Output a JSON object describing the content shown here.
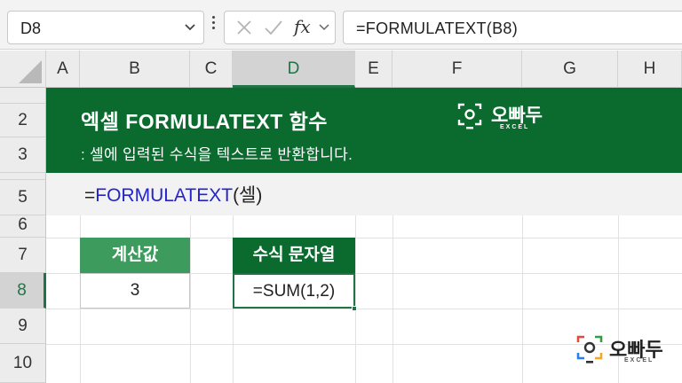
{
  "formula_bar": {
    "name_box": "D8",
    "fx_label": "fx",
    "formula": "=FORMULATEXT(B8)"
  },
  "columns": [
    "A",
    "B",
    "C",
    "D",
    "E",
    "F",
    "G",
    "H"
  ],
  "selected_column": "D",
  "rows": [
    "2",
    "3",
    "5",
    "6",
    "7",
    "8",
    "9",
    "10"
  ],
  "selected_row": "8",
  "banner": {
    "title": "엑셀 FORMULATEXT 함수",
    "subtitle": ": 셀에 입력된 수식을 텍스트로 반환합니다.",
    "logo_text": "오빠두",
    "logo_sub": "EXCEL"
  },
  "syntax": {
    "prefix": "=",
    "function_name": "FORMULATEXT",
    "args": "(셀)"
  },
  "table": {
    "header_value": "계산값",
    "header_formula": "수식 문자열",
    "value": "3",
    "formula_text": "=SUM(1,2)"
  },
  "watermark": {
    "logo_text": "오빠두",
    "logo_sub": "EXCEL"
  },
  "colors": {
    "excel_green": "#217346",
    "banner_green": "#0b6b2f",
    "header_green": "#3d9b5e",
    "function_blue": "#2424cc"
  }
}
